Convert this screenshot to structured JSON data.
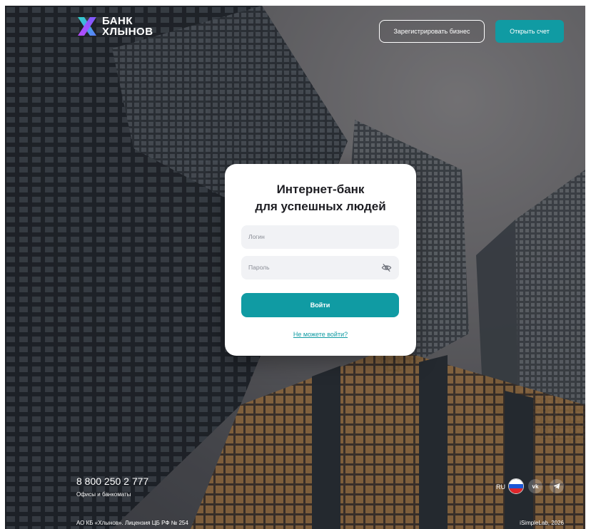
{
  "brand": {
    "name_line1": "БАНК",
    "name_line2": "ХЛЫНОВ",
    "logo_icon": "x-logo-icon",
    "accent_color": "#109ba3"
  },
  "header": {
    "register_label": "Зарегистрировать бизнес",
    "open_account_label": "Открыть счет"
  },
  "login_card": {
    "title_line1": "Интернет-банк",
    "title_line2": "для успешных людей",
    "login_placeholder": "Логин",
    "password_placeholder": "Пароль",
    "password_toggle_icon": "eye-off-icon",
    "submit_label": "Войти",
    "forgot_link": "Не можете войти?"
  },
  "footer": {
    "phone": "8 800 250 2 777",
    "offices_link": "Офисы и банкоматы",
    "legal": "АО КБ «Хлынов». Лицензия ЦБ РФ № 254",
    "copyright": "iSimpleLab, 2026",
    "language": "RU",
    "flag_icon": "russia-flag-icon",
    "social": [
      {
        "icon": "vk-icon",
        "glyph": "vk"
      },
      {
        "icon": "telegram-icon",
        "glyph": ""
      }
    ]
  }
}
